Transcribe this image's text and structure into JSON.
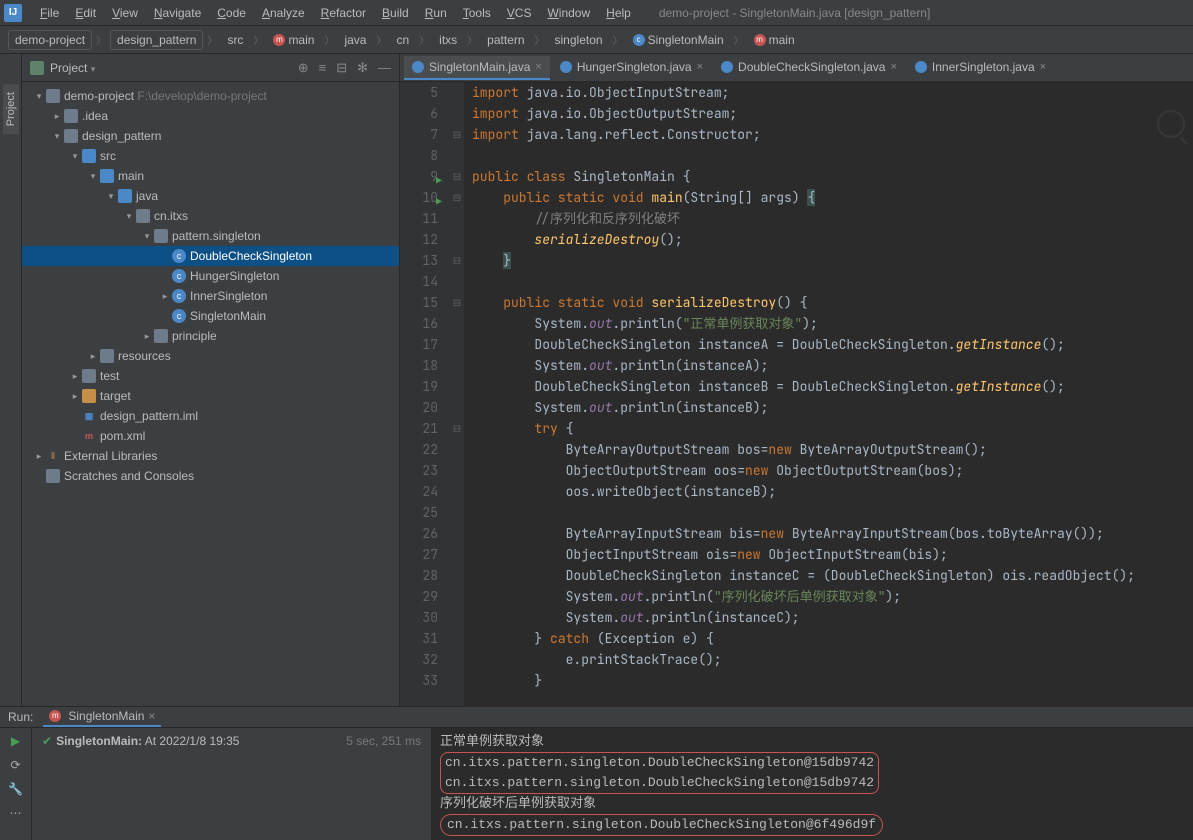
{
  "window_title": "demo-project - SingletonMain.java [design_pattern]",
  "menu": [
    "File",
    "Edit",
    "View",
    "Navigate",
    "Code",
    "Analyze",
    "Refactor",
    "Build",
    "Run",
    "Tools",
    "VCS",
    "Window",
    "Help"
  ],
  "breadcrumb": [
    "demo-project",
    "design_pattern",
    "src",
    "main",
    "java",
    "cn",
    "itxs",
    "pattern",
    "singleton",
    "SingletonMain",
    "main"
  ],
  "sidebar": {
    "title": "Project",
    "rail": "Project"
  },
  "tree": [
    {
      "depth": 0,
      "arrow": "▾",
      "icon": "folder",
      "label": "demo-project",
      "hint": " F:\\develop\\demo-project"
    },
    {
      "depth": 1,
      "arrow": "▸",
      "icon": "folder",
      "label": ".idea"
    },
    {
      "depth": 1,
      "arrow": "▾",
      "icon": "folder",
      "label": "design_pattern"
    },
    {
      "depth": 2,
      "arrow": "▾",
      "icon": "folder-src",
      "label": "src"
    },
    {
      "depth": 3,
      "arrow": "▾",
      "icon": "folder-src",
      "label": "main"
    },
    {
      "depth": 4,
      "arrow": "▾",
      "icon": "folder-src",
      "label": "java"
    },
    {
      "depth": 5,
      "arrow": "▾",
      "icon": "folder",
      "label": "cn.itxs"
    },
    {
      "depth": 6,
      "arrow": "▾",
      "icon": "folder",
      "label": "pattern.singleton"
    },
    {
      "depth": 7,
      "arrow": "",
      "icon": "class",
      "label": "DoubleCheckSingleton",
      "selected": true
    },
    {
      "depth": 7,
      "arrow": "",
      "icon": "class",
      "label": "HungerSingleton"
    },
    {
      "depth": 7,
      "arrow": "▸",
      "icon": "class",
      "label": "InnerSingleton"
    },
    {
      "depth": 7,
      "arrow": "",
      "icon": "class",
      "label": "SingletonMain"
    },
    {
      "depth": 6,
      "arrow": "▸",
      "icon": "folder",
      "label": "principle"
    },
    {
      "depth": 3,
      "arrow": "▸",
      "icon": "folder",
      "label": "resources"
    },
    {
      "depth": 2,
      "arrow": "▸",
      "icon": "folder",
      "label": "test"
    },
    {
      "depth": 2,
      "arrow": "▸",
      "icon": "folder-orange",
      "label": "target"
    },
    {
      "depth": 2,
      "arrow": "",
      "icon": "module",
      "label": "design_pattern.iml"
    },
    {
      "depth": 2,
      "arrow": "",
      "icon": "maven",
      "label": "pom.xml"
    },
    {
      "depth": 0,
      "arrow": "▸",
      "icon": "lib",
      "label": "External Libraries"
    },
    {
      "depth": 0,
      "arrow": "",
      "icon": "folder",
      "label": "Scratches and Consoles"
    }
  ],
  "editor_tabs": [
    {
      "label": "SingletonMain.java",
      "active": true
    },
    {
      "label": "HungerSingleton.java",
      "active": false
    },
    {
      "label": "DoubleCheckSingleton.java",
      "active": false
    },
    {
      "label": "InnerSingleton.java",
      "active": false
    }
  ],
  "code_start_line": 5,
  "code_lines": [
    {
      "n": 5,
      "html": "<span class='kw'>import</span> java.io.ObjectInputStream;"
    },
    {
      "n": 6,
      "html": "<span class='kw'>import</span> java.io.ObjectOutputStream;"
    },
    {
      "n": 7,
      "html": "<span class='kw'>import</span> java.lang.reflect.Constructor;"
    },
    {
      "n": 8,
      "html": ""
    },
    {
      "n": 9,
      "html": "<span class='kw'>public class</span> SingletonMain {",
      "run": true
    },
    {
      "n": 10,
      "html": "    <span class='kw'>public static void</span> <span class='fn'>main</span>(String[] args) <span class='hl-brace'>{</span>",
      "run": true
    },
    {
      "n": 11,
      "html": "        <span class='cmt'>//序列化和反序列化破坏</span>"
    },
    {
      "n": 12,
      "html": "        <span class='fn-i'>serializeDestroy</span>();"
    },
    {
      "n": 13,
      "html": "    <span class='cur hl-brace'>}</span>"
    },
    {
      "n": 14,
      "html": ""
    },
    {
      "n": 15,
      "html": "    <span class='kw'>public static void</span> <span class='fn'>serializeDestroy</span>() {"
    },
    {
      "n": 16,
      "html": "        System.<span class='fld'>out</span>.println(<span class='str'>\"正常单例获取对象\"</span>);"
    },
    {
      "n": 17,
      "html": "        DoubleCheckSingleton instanceA = DoubleCheckSingleton.<span class='fn-i'>getInstance</span>();"
    },
    {
      "n": 18,
      "html": "        System.<span class='fld'>out</span>.println(instanceA);"
    },
    {
      "n": 19,
      "html": "        DoubleCheckSingleton instanceB = DoubleCheckSingleton.<span class='fn-i'>getInstance</span>();"
    },
    {
      "n": 20,
      "html": "        System.<span class='fld'>out</span>.println(instanceB);"
    },
    {
      "n": 21,
      "html": "        <span class='kw'>try</span> {"
    },
    {
      "n": 22,
      "html": "            ByteArrayOutputStream bos=<span class='kw'>new</span> ByteArrayOutputStream();"
    },
    {
      "n": 23,
      "html": "            ObjectOutputStream oos=<span class='kw'>new</span> ObjectOutputStream(bos);"
    },
    {
      "n": 24,
      "html": "            oos.writeObject(instanceB);"
    },
    {
      "n": 25,
      "html": ""
    },
    {
      "n": 26,
      "html": "            ByteArrayInputStream bis=<span class='kw'>new</span> ByteArrayInputStream(bos.toByteArray());"
    },
    {
      "n": 27,
      "html": "            ObjectInputStream ois=<span class='kw'>new</span> ObjectInputStream(bis);"
    },
    {
      "n": 28,
      "html": "            DoubleCheckSingleton instanceC = (DoubleCheckSingleton) ois.readObject();"
    },
    {
      "n": 29,
      "html": "            System.<span class='fld'>out</span>.println(<span class='str'>\"序列化破坏后单例获取对象\"</span>);"
    },
    {
      "n": 30,
      "html": "            System.<span class='fld'>out</span>.println(instanceC);"
    },
    {
      "n": 31,
      "html": "        } <span class='kw'>catch</span> (Exception e) {"
    },
    {
      "n": 32,
      "html": "            e.printStackTrace();"
    },
    {
      "n": 33,
      "html": "        }"
    }
  ],
  "run": {
    "label": "Run:",
    "tab": "SingletonMain",
    "status_name": "SingletonMain:",
    "status_time": "At 2022/1/8 19:35",
    "duration": "5 sec, 251 ms",
    "console": [
      {
        "text": "正常单例获取对象"
      },
      {
        "text": "cn.itxs.pattern.singleton.DoubleCheckSingleton@15db9742",
        "box": "rect-top"
      },
      {
        "text": "cn.itxs.pattern.singleton.DoubleCheckSingleton@15db9742",
        "box": "rect-bot"
      },
      {
        "text": "序列化破坏后单例获取对象"
      },
      {
        "text": "cn.itxs.pattern.singleton.DoubleCheckSingleton@6f496d9f",
        "box": "oval"
      }
    ]
  }
}
